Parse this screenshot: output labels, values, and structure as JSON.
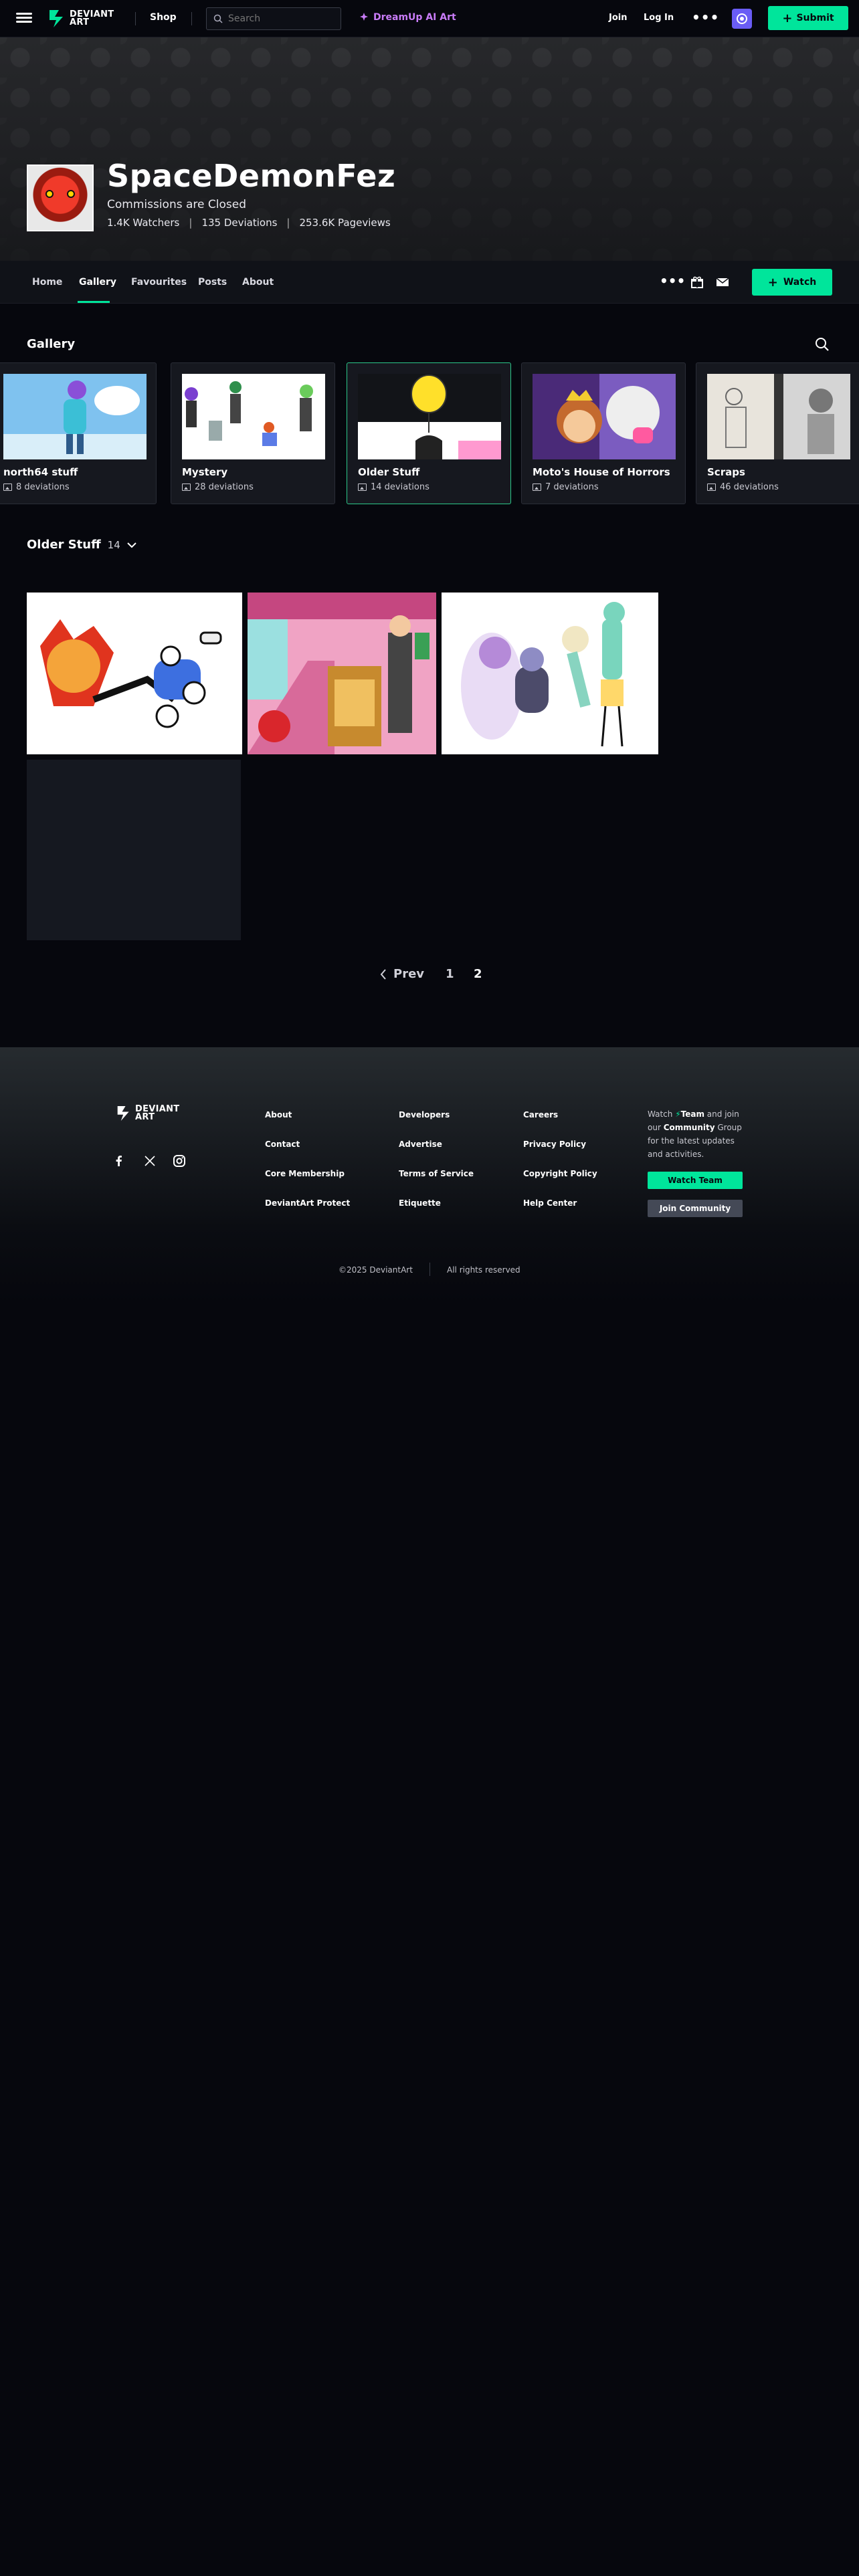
{
  "topbar": {
    "logo_line1": "DEVIANT",
    "logo_line2": "ART",
    "shop": "Shop",
    "search_placeholder": "Search",
    "dreamup": "DreamUp AI Art",
    "join": "Join",
    "login": "Log In",
    "more": "•••",
    "submit": "Submit"
  },
  "profile": {
    "username": "SpaceDemonFez",
    "tagline": "Commissions are Closed",
    "watchers": "1.4K Watchers",
    "deviations": "135 Deviations",
    "pageviews": "253.6K Pageviews"
  },
  "subnav": {
    "items": [
      "Home",
      "Gallery",
      "Favourites",
      "Posts",
      "About"
    ],
    "active": "Gallery",
    "watch": "Watch"
  },
  "gallery": {
    "title": "Gallery",
    "folders": [
      {
        "name": "north64 stuff",
        "count": "8 deviations"
      },
      {
        "name": "Mystery",
        "count": "28 deviations"
      },
      {
        "name": "Older Stuff",
        "count": "14 deviations"
      },
      {
        "name": "Moto's House of Horrors",
        "count": "7 deviations"
      },
      {
        "name": "Scraps",
        "count": "46 deviations"
      }
    ],
    "current_folder": "Older Stuff",
    "current_count": "14"
  },
  "pagination": {
    "prev": "Prev",
    "pages": [
      "1",
      "2"
    ],
    "current": "2"
  },
  "footer": {
    "logo_line1": "DEVIANT",
    "logo_line2": "ART",
    "columns": [
      [
        "About",
        "Contact",
        "Core Membership",
        "DeviantArt Protect"
      ],
      [
        "Developers",
        "Advertise",
        "Terms of Service",
        "Etiquette"
      ],
      [
        "Careers",
        "Privacy Policy",
        "Copyright Policy",
        "Help Center"
      ]
    ],
    "team_text_1": "Watch",
    "team_name": "Team",
    "team_text_2": "and join our",
    "community": "Community",
    "team_text_3": "Group for the latest updates and activities.",
    "watch_team": "Watch Team",
    "join_community": "Join Community",
    "copyright": "©2025 DeviantArt",
    "rights": "All rights reserved"
  },
  "colors": {
    "accent": "#00e59b",
    "dreamup": "#c97cf8",
    "background": "#06070d"
  }
}
